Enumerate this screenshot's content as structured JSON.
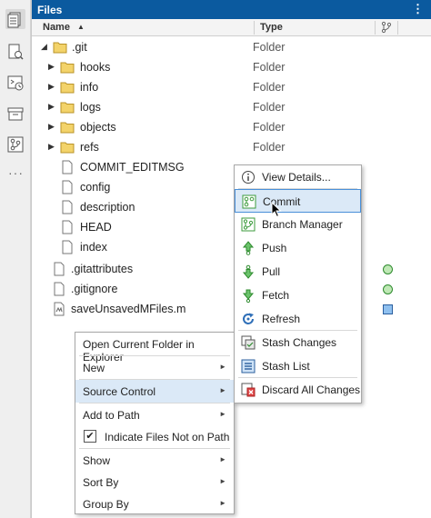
{
  "panel": {
    "title": "Files"
  },
  "header": {
    "name": "Name",
    "type": "Type"
  },
  "rows": [
    {
      "name": ".git",
      "type": "Folder"
    },
    {
      "name": "hooks",
      "type": "Folder"
    },
    {
      "name": "info",
      "type": "Folder"
    },
    {
      "name": "logs",
      "type": "Folder"
    },
    {
      "name": "objects",
      "type": "Folder"
    },
    {
      "name": "refs",
      "type": "Folder"
    },
    {
      "name": "COMMIT_EDITMSG",
      "type": ""
    },
    {
      "name": "config",
      "type": ""
    },
    {
      "name": "description",
      "type": ""
    },
    {
      "name": "HEAD",
      "type": ""
    },
    {
      "name": "index",
      "type": ""
    },
    {
      "name": ".gitattributes",
      "type": ""
    },
    {
      "name": ".gitignore",
      "type": ""
    },
    {
      "name": "saveUnsavedMFiles.m",
      "type": ""
    }
  ],
  "context_menu": {
    "items": [
      "Open Current Folder in Explorer",
      "New",
      "Source Control",
      "Add to Path",
      "Indicate Files Not on Path",
      "Show",
      "Sort By",
      "Group By"
    ]
  },
  "source_control_menu": {
    "items": [
      "View Details...",
      "Commit",
      "Branch Manager",
      "Push",
      "Pull",
      "Fetch",
      "Refresh",
      "Stash Changes",
      "Stash List",
      "Discard All Changes"
    ]
  },
  "colors": {
    "titlebar": "#0b5a9f",
    "folder": "#e8c24a",
    "highlight": "#dbe9f7",
    "git_green": "#3d9b3d"
  }
}
